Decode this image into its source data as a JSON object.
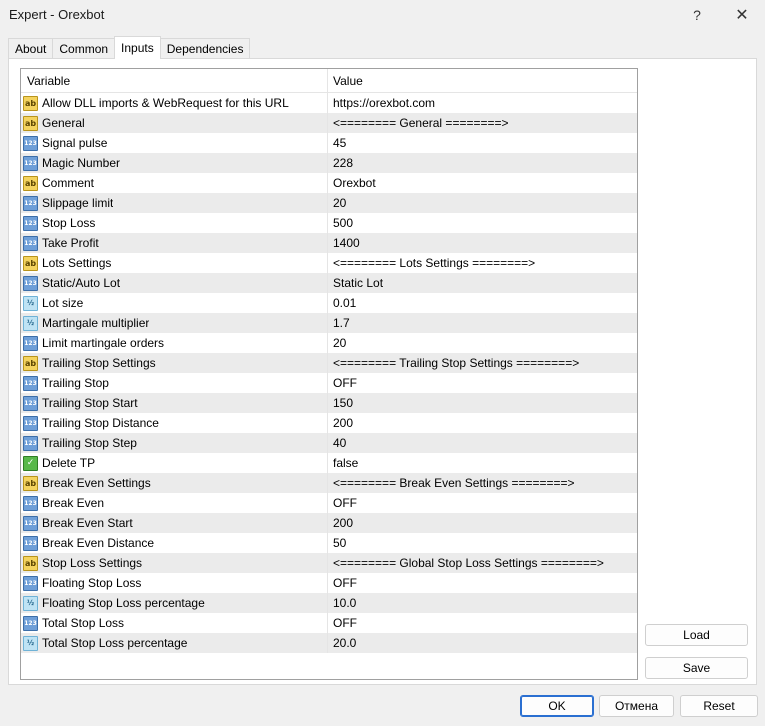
{
  "window": {
    "title": "Expert - Orexbot",
    "help_glyph": "?",
    "close_glyph": "✕"
  },
  "tabs": [
    {
      "label": "About"
    },
    {
      "label": "Common"
    },
    {
      "label": "Inputs"
    },
    {
      "label": "Dependencies"
    }
  ],
  "grid": {
    "headers": {
      "variable": "Variable",
      "value": "Value"
    },
    "rows": [
      {
        "icon": "string-icon",
        "variable": "Allow DLL imports & WebRequest for this URL",
        "value": "https://orexbot.com"
      },
      {
        "icon": "string-icon",
        "variable": "General",
        "value": "<======== General ========>"
      },
      {
        "icon": "integer-icon",
        "variable": "Signal pulse",
        "value": "45"
      },
      {
        "icon": "integer-icon",
        "variable": "Magic Number",
        "value": "228"
      },
      {
        "icon": "string-icon",
        "variable": "Comment",
        "value": "Orexbot"
      },
      {
        "icon": "integer-icon",
        "variable": "Slippage limit",
        "value": "20"
      },
      {
        "icon": "integer-icon",
        "variable": "Stop Loss",
        "value": "500"
      },
      {
        "icon": "integer-icon",
        "variable": "Take Profit",
        "value": "1400"
      },
      {
        "icon": "string-icon",
        "variable": "Lots Settings",
        "value": "<======== Lots Settings ========>"
      },
      {
        "icon": "integer-icon",
        "variable": "Static/Auto Lot",
        "value": "Static Lot"
      },
      {
        "icon": "double-icon",
        "variable": "Lot size",
        "value": "0.01"
      },
      {
        "icon": "double-icon",
        "variable": "Martingale multiplier",
        "value": "1.7"
      },
      {
        "icon": "integer-icon",
        "variable": "Limit martingale orders",
        "value": "20"
      },
      {
        "icon": "string-icon",
        "variable": "Trailing Stop Settings",
        "value": "<======== Trailing Stop Settings ========>"
      },
      {
        "icon": "integer-icon",
        "variable": "Trailing Stop",
        "value": "OFF"
      },
      {
        "icon": "integer-icon",
        "variable": "Trailing Stop Start",
        "value": "150"
      },
      {
        "icon": "integer-icon",
        "variable": "Trailing Stop Distance",
        "value": "200"
      },
      {
        "icon": "integer-icon",
        "variable": "Trailing Stop Step",
        "value": "40"
      },
      {
        "icon": "bool-icon",
        "variable": "Delete TP",
        "value": "false"
      },
      {
        "icon": "string-icon",
        "variable": "Break Even Settings",
        "value": "<======== Break Even Settings ========>"
      },
      {
        "icon": "integer-icon",
        "variable": "Break Even",
        "value": "OFF"
      },
      {
        "icon": "integer-icon",
        "variable": "Break Even Start",
        "value": "200"
      },
      {
        "icon": "integer-icon",
        "variable": "Break Even Distance",
        "value": "50"
      },
      {
        "icon": "string-icon",
        "variable": "Stop Loss Settings",
        "value": "<======== Global Stop Loss Settings ========>"
      },
      {
        "icon": "integer-icon",
        "variable": "Floating Stop Loss",
        "value": "OFF"
      },
      {
        "icon": "double-icon",
        "variable": "Floating Stop Loss percentage",
        "value": "10.0"
      },
      {
        "icon": "integer-icon",
        "variable": "Total Stop Loss",
        "value": "OFF"
      },
      {
        "icon": "double-icon",
        "variable": "Total Stop Loss percentage",
        "value": "20.0"
      }
    ]
  },
  "icon_glyphs": {
    "string-icon": "ab",
    "integer-icon": "123",
    "double-icon": "½",
    "bool-icon": "✓"
  },
  "buttons": {
    "load": "Load",
    "save": "Save",
    "ok": "OK",
    "cancel": "Отмена",
    "reset": "Reset"
  },
  "colors": {
    "selected_tab_bg": "#ffffff",
    "ok_border": "#2a6fd1",
    "alt_row_bg": "#ebebeb"
  }
}
